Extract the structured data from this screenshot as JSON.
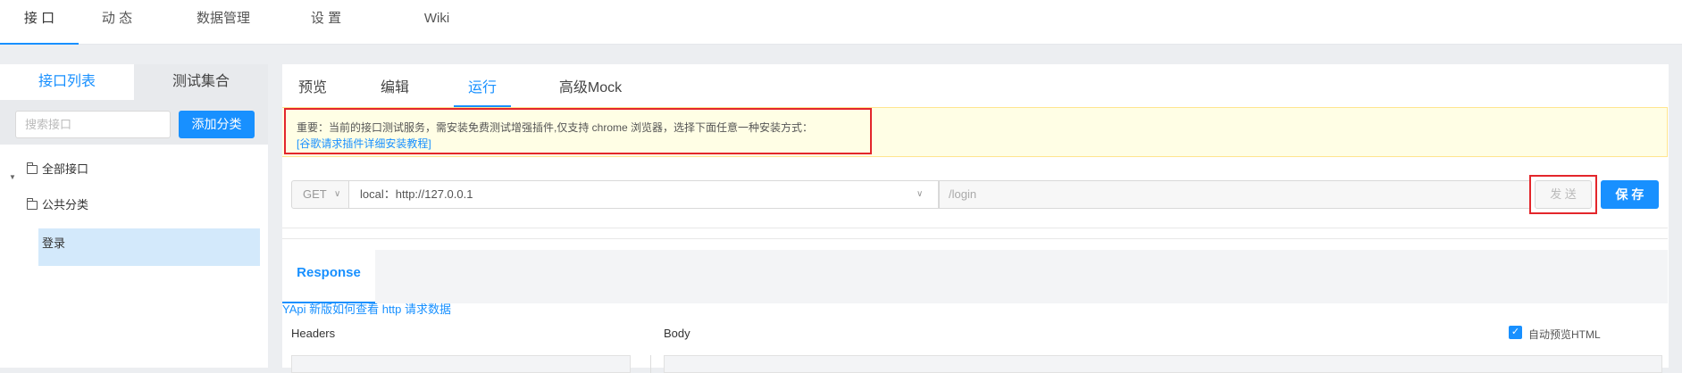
{
  "topnav": {
    "tabs": [
      {
        "label": "接 口",
        "active": true
      },
      {
        "label": "动 态",
        "active": false
      },
      {
        "label": "数据管理",
        "active": false
      },
      {
        "label": "设 置",
        "active": false
      },
      {
        "label": "Wiki",
        "active": false
      }
    ]
  },
  "sidebar": {
    "tabs": [
      {
        "label": "接口列表",
        "active": true
      },
      {
        "label": "测试集合",
        "active": false
      }
    ],
    "search_placeholder": "搜索接口",
    "add_button": "添加分类",
    "tree": {
      "all": "全部接口",
      "category": "公共分类",
      "leaf": "登录"
    }
  },
  "main": {
    "tabs": [
      {
        "label": "预览",
        "active": false
      },
      {
        "label": "编辑",
        "active": false
      },
      {
        "label": "运行",
        "active": true
      },
      {
        "label": "高级Mock",
        "active": false
      }
    ],
    "notice": {
      "text": "重要：当前的接口测试服务，需安装免费测试增强插件,仅支持 chrome 浏览器，选择下面任意一种安装方式：",
      "link": "[谷歌请求插件详细安装教程]"
    },
    "request": {
      "method": "GET",
      "env": "local：http://127.0.0.1",
      "path": "/login",
      "send_label": "发 送",
      "save_label": "保 存"
    },
    "response": {
      "tab_label": "Response",
      "how_link": "YApi 新版如何查看 http 请求数据",
      "headers_label": "Headers",
      "body_label": "Body",
      "auto_preview_label": "自动预览HTML",
      "auto_preview_checked": true
    }
  },
  "colors": {
    "accent": "#1890ff",
    "highlight": "#e3262b",
    "notice_bg": "#fffee5"
  }
}
